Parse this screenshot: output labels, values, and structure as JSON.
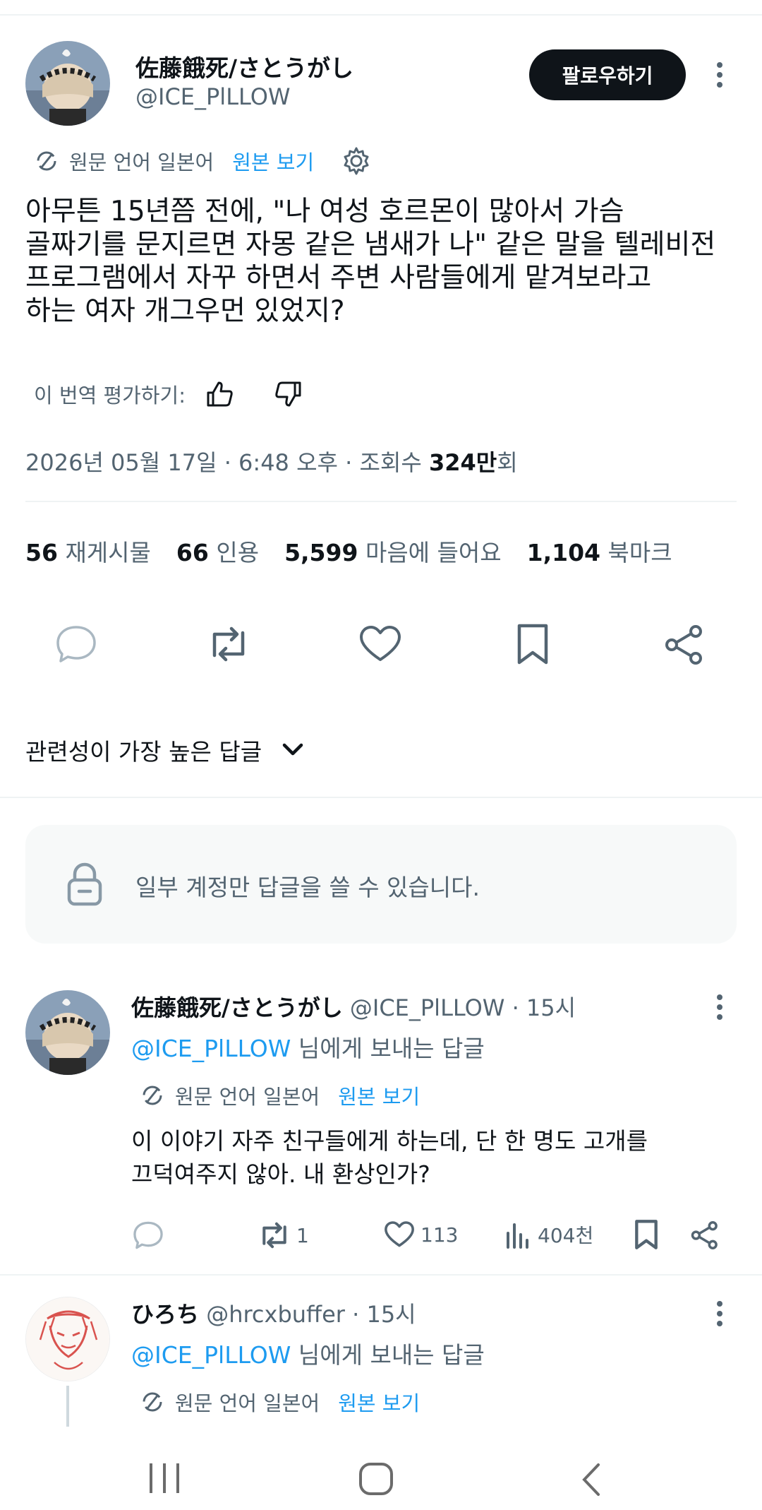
{
  "post": {
    "author_name": "佐藤餓死/さとうがし",
    "author_handle": "@ICE_PlLLOW",
    "follow_label": "팔로우하기",
    "translation_note": "원문 언어 일본어",
    "view_original": "원본 보기",
    "text_lines": [
      "아무튼 15년쯤 전에, \"나 여성 호르몬이 많아서 가슴",
      "골짜기를 문지르면 자몽 같은 냄새가 나\" 같은 말을 텔레비전",
      "프로그램에서 자꾸 하면서 주변 사람들에게 맡겨보라고",
      "하는 여자 개그우먼 있었지?"
    ],
    "rate_translation": "이 번역 평가하기:",
    "timestamp": "2026년 05월 17일 · 6:48 오후 · 조회수 ",
    "views_bold": "324만",
    "views_suffix": "회",
    "stats": [
      {
        "num": "56",
        "label": "재게시물"
      },
      {
        "num": "66",
        "label": "인용"
      },
      {
        "num": "5,599",
        "label": "마음에 들어요"
      },
      {
        "num": "1,104",
        "label": "북마크"
      }
    ],
    "sort_label": "관련성이 가장 높은 답글"
  },
  "reply_restriction": "일부 계정만 답글을 쓸 수 있습니다.",
  "replies": [
    {
      "name": "佐藤餓死/さとうがし",
      "handle": "@ICE_PlLLOW",
      "time": "· 15시",
      "reply_to": "@ICE_PlLLOW",
      "reply_to_suffix": " 님에게 보내는 답글",
      "translation_note": "원문 언어 일본어",
      "view_original": "원본 보기",
      "text_lines": [
        "이 이야기 자주 친구들에게 하는데, 단 한 명도 고개를",
        "끄덕여주지 않아. 내 환상인가?"
      ],
      "reposts": "1",
      "likes": "113",
      "views": "404천"
    },
    {
      "name": "ひろち",
      "handle": "@hrcxbuffer",
      "time": "· 15시",
      "reply_to": "@ICE_PlLLOW",
      "reply_to_suffix": " 님에게 보내는 답글",
      "translation_note": "원문 언어 일본어",
      "view_original": "원본 보기"
    }
  ],
  "colors": {
    "accent": "#1d9bf0",
    "text": "#0f1419",
    "muted": "#536471",
    "border": "#eff3f4"
  }
}
